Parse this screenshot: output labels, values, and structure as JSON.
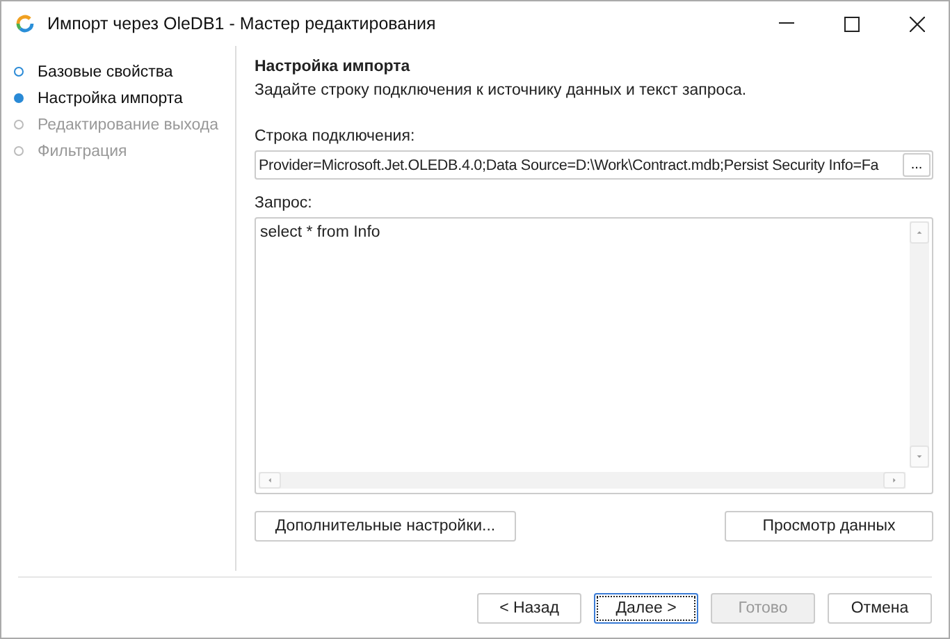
{
  "window": {
    "title": "Импорт через OleDB1 - Мастер редактирования"
  },
  "steps": [
    {
      "label": "Базовые свойства",
      "selected": false,
      "disabled": false
    },
    {
      "label": "Настройка импорта",
      "selected": true,
      "disabled": false
    },
    {
      "label": "Редактирование выхода",
      "selected": false,
      "disabled": true
    },
    {
      "label": "Фильтрация",
      "selected": false,
      "disabled": true
    }
  ],
  "page": {
    "heading": "Настройка импорта",
    "description": "Задайте строку подключения к источнику данных и текст запроса.",
    "connection_label": "Строка подключения:",
    "connection_value": "Provider=Microsoft.Jet.OLEDB.4.0;Data Source=D:\\Work\\Contract.mdb;Persist Security Info=Fa",
    "browse_button": "...",
    "query_label": "Запрос:",
    "query_value": "select * from Info",
    "advanced_button": "Дополнительные настройки...",
    "preview_button": "Просмотр данных"
  },
  "buttons": [
    {
      "label": "< Назад",
      "disabled": false,
      "focused": false
    },
    {
      "label": "Далее >",
      "disabled": false,
      "focused": true
    },
    {
      "label": "Готово",
      "disabled": true,
      "focused": false
    },
    {
      "label": "Отмена",
      "disabled": false,
      "focused": false
    }
  ]
}
